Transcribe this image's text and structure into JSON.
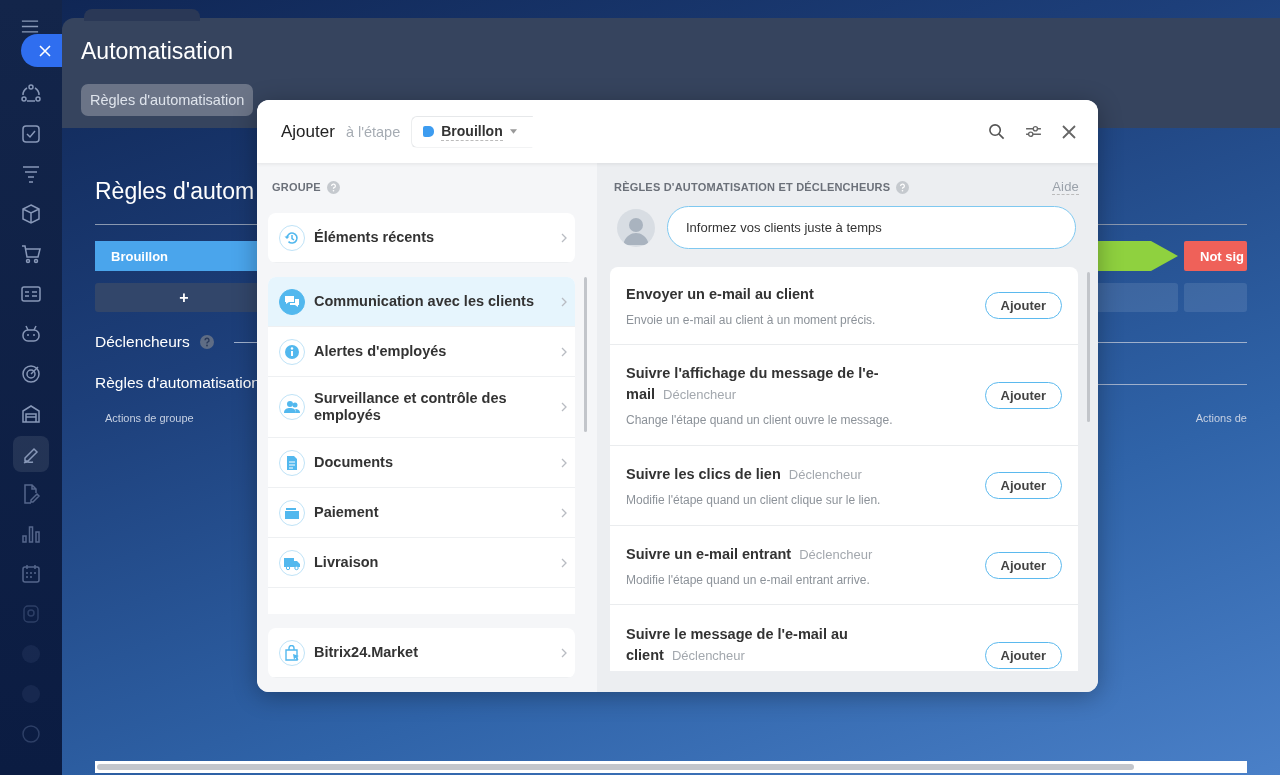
{
  "sidebar": {
    "items": [
      {
        "selected": false
      },
      {
        "selected": false
      },
      {
        "selected": false
      },
      {
        "selected": false
      },
      {
        "selected": false
      },
      {
        "selected": false
      },
      {
        "selected": false
      },
      {
        "selected": false
      },
      {
        "selected": false
      },
      {
        "selected": true
      },
      {
        "selected": false
      },
      {
        "selected": false
      },
      {
        "selected": false
      },
      {
        "selected": false
      },
      {
        "selected": false
      },
      {
        "selected": false
      },
      {
        "selected": false
      }
    ]
  },
  "page": {
    "title": "Automatisation",
    "tabs": [
      {
        "label": "Règles d'automatisation",
        "selected": true
      }
    ],
    "heading": "Règles d'autom",
    "stages": [
      {
        "name": "Brouillon",
        "color": "#4aa5ec",
        "add_label": "+"
      },
      {
        "color": "#8fd13f"
      },
      {
        "name": "Not sig",
        "color": "#ef6159"
      }
    ],
    "triggers_label": "Déclencheurs",
    "rules_label": "Règles d'automatisation",
    "group_actions": [
      "Actions de groupe",
      "Actions de"
    ]
  },
  "modal": {
    "title": "Ajouter",
    "stage_prefix": "à l'étape",
    "stage": {
      "name": "Brouillon",
      "color": "#3d9cf0"
    },
    "group_heading": "GROUPE",
    "recent": {
      "label": "Éléments récents"
    },
    "groups": [
      {
        "label": "Communication avec les clients",
        "selected": true
      },
      {
        "label": "Alertes d'employés",
        "selected": false
      },
      {
        "label": "Surveillance et contrôle des employés",
        "selected": false
      },
      {
        "label": "Documents",
        "selected": false
      },
      {
        "label": "Paiement",
        "selected": false
      },
      {
        "label": "Livraison",
        "selected": false
      }
    ],
    "market": {
      "label": "Bitrix24.Market"
    },
    "rules_heading": "RÈGLES D'AUTOMATISATION ET DÉCLENCHEURS",
    "help_link": "Aide",
    "hint": "Informez vos clients juste à temps",
    "rules": [
      {
        "title": "Envoyer un e-mail au client",
        "description": "Envoie un e-mail au client à un moment précis.",
        "button": "Ajouter"
      },
      {
        "title": "Suivre l'affichage du message de l'e-mail",
        "tag": "Déclencheur",
        "description": "Change l'étape quand un client ouvre le message.",
        "button": "Ajouter"
      },
      {
        "title": "Suivre les clics de lien",
        "tag": "Déclencheur",
        "description": "Modifie l'étape quand un client clique sur le lien.",
        "button": "Ajouter"
      },
      {
        "title": "Suivre un e-mail entrant",
        "tag": "Déclencheur",
        "description": "Modifie l'étape quand un e-mail entrant arrive.",
        "button": "Ajouter"
      },
      {
        "title": "Suivre le message de l'e-mail au client",
        "tag": "Déclencheur",
        "button": "Ajouter"
      }
    ]
  }
}
